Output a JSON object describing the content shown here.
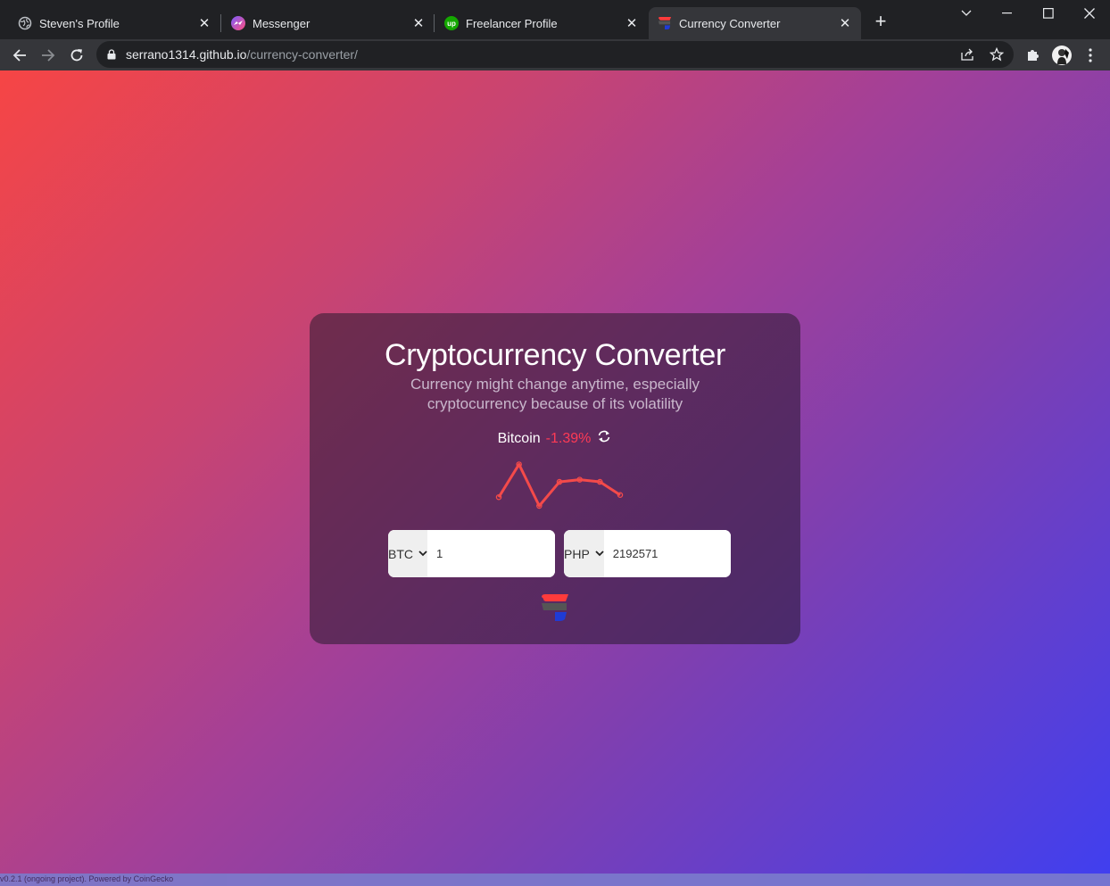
{
  "browser": {
    "tabs": [
      {
        "title": "Steven's Profile",
        "icon": "globe-icon"
      },
      {
        "title": "Messenger",
        "icon": "messenger-icon"
      },
      {
        "title": "Freelancer Profile",
        "icon": "upwork-icon"
      },
      {
        "title": "Currency Converter",
        "icon": "app-logo-icon",
        "active": true
      }
    ],
    "url_host": "serrano1314.github.io",
    "url_path": "/currency-converter/"
  },
  "converter": {
    "title": "Cryptocurrency Converter",
    "subtitle": "Currency might change anytime, especially cryptocurrency because of its volatility",
    "coin_name": "Bitcoin",
    "coin_change": "-1.39%",
    "from_currency": "BTC",
    "from_amount": "1",
    "to_currency": "PHP",
    "to_amount": "2192571",
    "sparkline": [
      0.2,
      0.95,
      0.0,
      0.55,
      0.6,
      0.55,
      0.25
    ],
    "colors": {
      "accent": "#ff3a55",
      "line": "#f44a4a"
    }
  },
  "footer": {
    "text": "v0.2.1 (ongoing project). Powered by CoinGecko"
  }
}
